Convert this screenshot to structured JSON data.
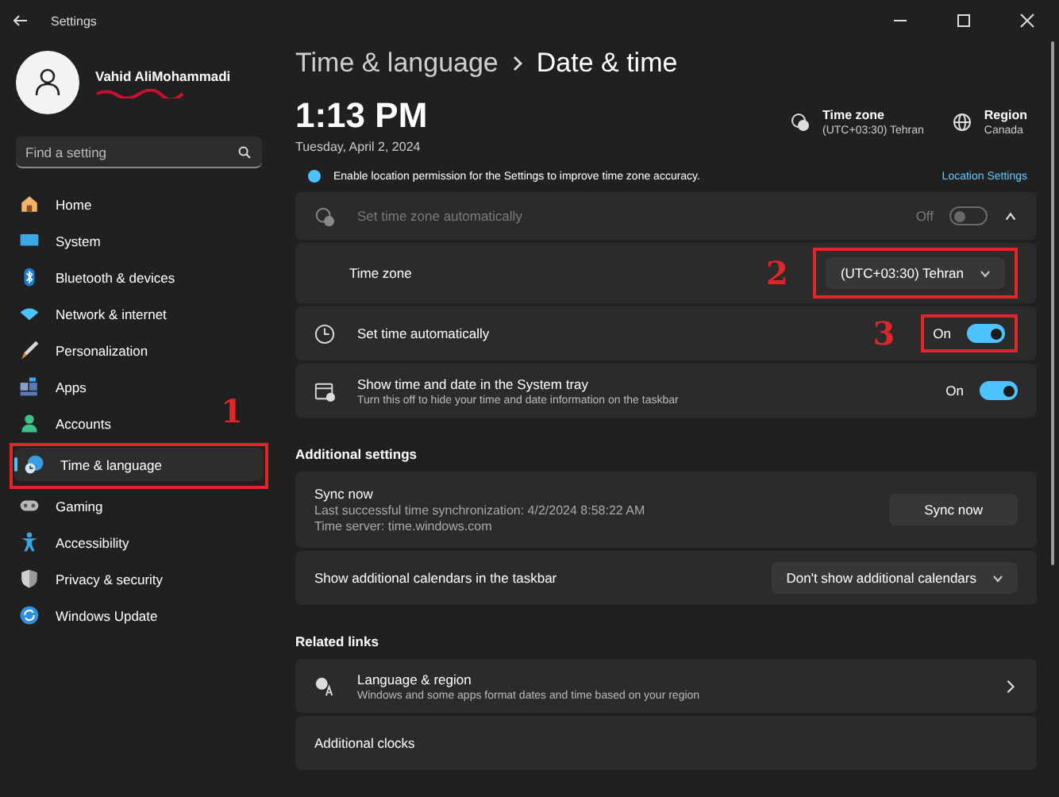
{
  "title_bar": {
    "title": "Settings"
  },
  "user": {
    "name": "Vahid AliMohammadi"
  },
  "search": {
    "placeholder": "Find a setting"
  },
  "sidebar": {
    "items": [
      {
        "label": "Home",
        "selected": false
      },
      {
        "label": "System",
        "selected": false
      },
      {
        "label": "Bluetooth & devices",
        "selected": false
      },
      {
        "label": "Network & internet",
        "selected": false
      },
      {
        "label": "Personalization",
        "selected": false
      },
      {
        "label": "Apps",
        "selected": false
      },
      {
        "label": "Accounts",
        "selected": false
      },
      {
        "label": "Time & language",
        "selected": true,
        "annotation": "1"
      },
      {
        "label": "Gaming",
        "selected": false
      },
      {
        "label": "Accessibility",
        "selected": false
      },
      {
        "label": "Privacy & security",
        "selected": false
      },
      {
        "label": "Windows Update",
        "selected": false
      }
    ]
  },
  "breadcrumb": {
    "parent": "Time & language",
    "current": "Date & time"
  },
  "clock": {
    "time": "1:13 PM",
    "date": "Tuesday, April 2, 2024"
  },
  "summary": [
    {
      "label": "Time zone",
      "value": "(UTC+03:30) Tehran"
    },
    {
      "label": "Region",
      "value": "Canada"
    }
  ],
  "notice": {
    "text": "Enable location permission for the Settings to improve time zone accuracy.",
    "link": "Location Settings"
  },
  "settings": [
    {
      "kind": "toggle",
      "label": "Set time zone automatically",
      "state_text": "Off",
      "on": false,
      "disabled": true,
      "expanded": true
    },
    {
      "kind": "dropdown",
      "label": "Time zone",
      "value": "(UTC+03:30) Tehran",
      "annotation": "2"
    },
    {
      "kind": "toggle",
      "label": "Set time automatically",
      "state_text": "On",
      "on": true,
      "disabled": false,
      "annotation": "3"
    },
    {
      "kind": "toggle",
      "label": "Show time and date in the System tray",
      "description": "Turn this off to hide your time and date information on the taskbar",
      "state_text": "On",
      "on": true,
      "disabled": false
    }
  ],
  "additional_settings": {
    "heading": "Additional settings",
    "rows": [
      {
        "kind": "button",
        "title": "Sync now",
        "lines": [
          "Last successful time synchronization: 4/2/2024 8:58:22 AM",
          "Time server: time.windows.com"
        ],
        "button": "Sync now"
      },
      {
        "kind": "dropdown",
        "title": "Show additional calendars in the taskbar",
        "value": "Don't show additional calendars"
      }
    ]
  },
  "related_links": {
    "heading": "Related links",
    "items": [
      {
        "title": "Language & region",
        "description": "Windows and some apps format dates and time based on your region"
      },
      {
        "title": "Additional clocks"
      }
    ]
  }
}
